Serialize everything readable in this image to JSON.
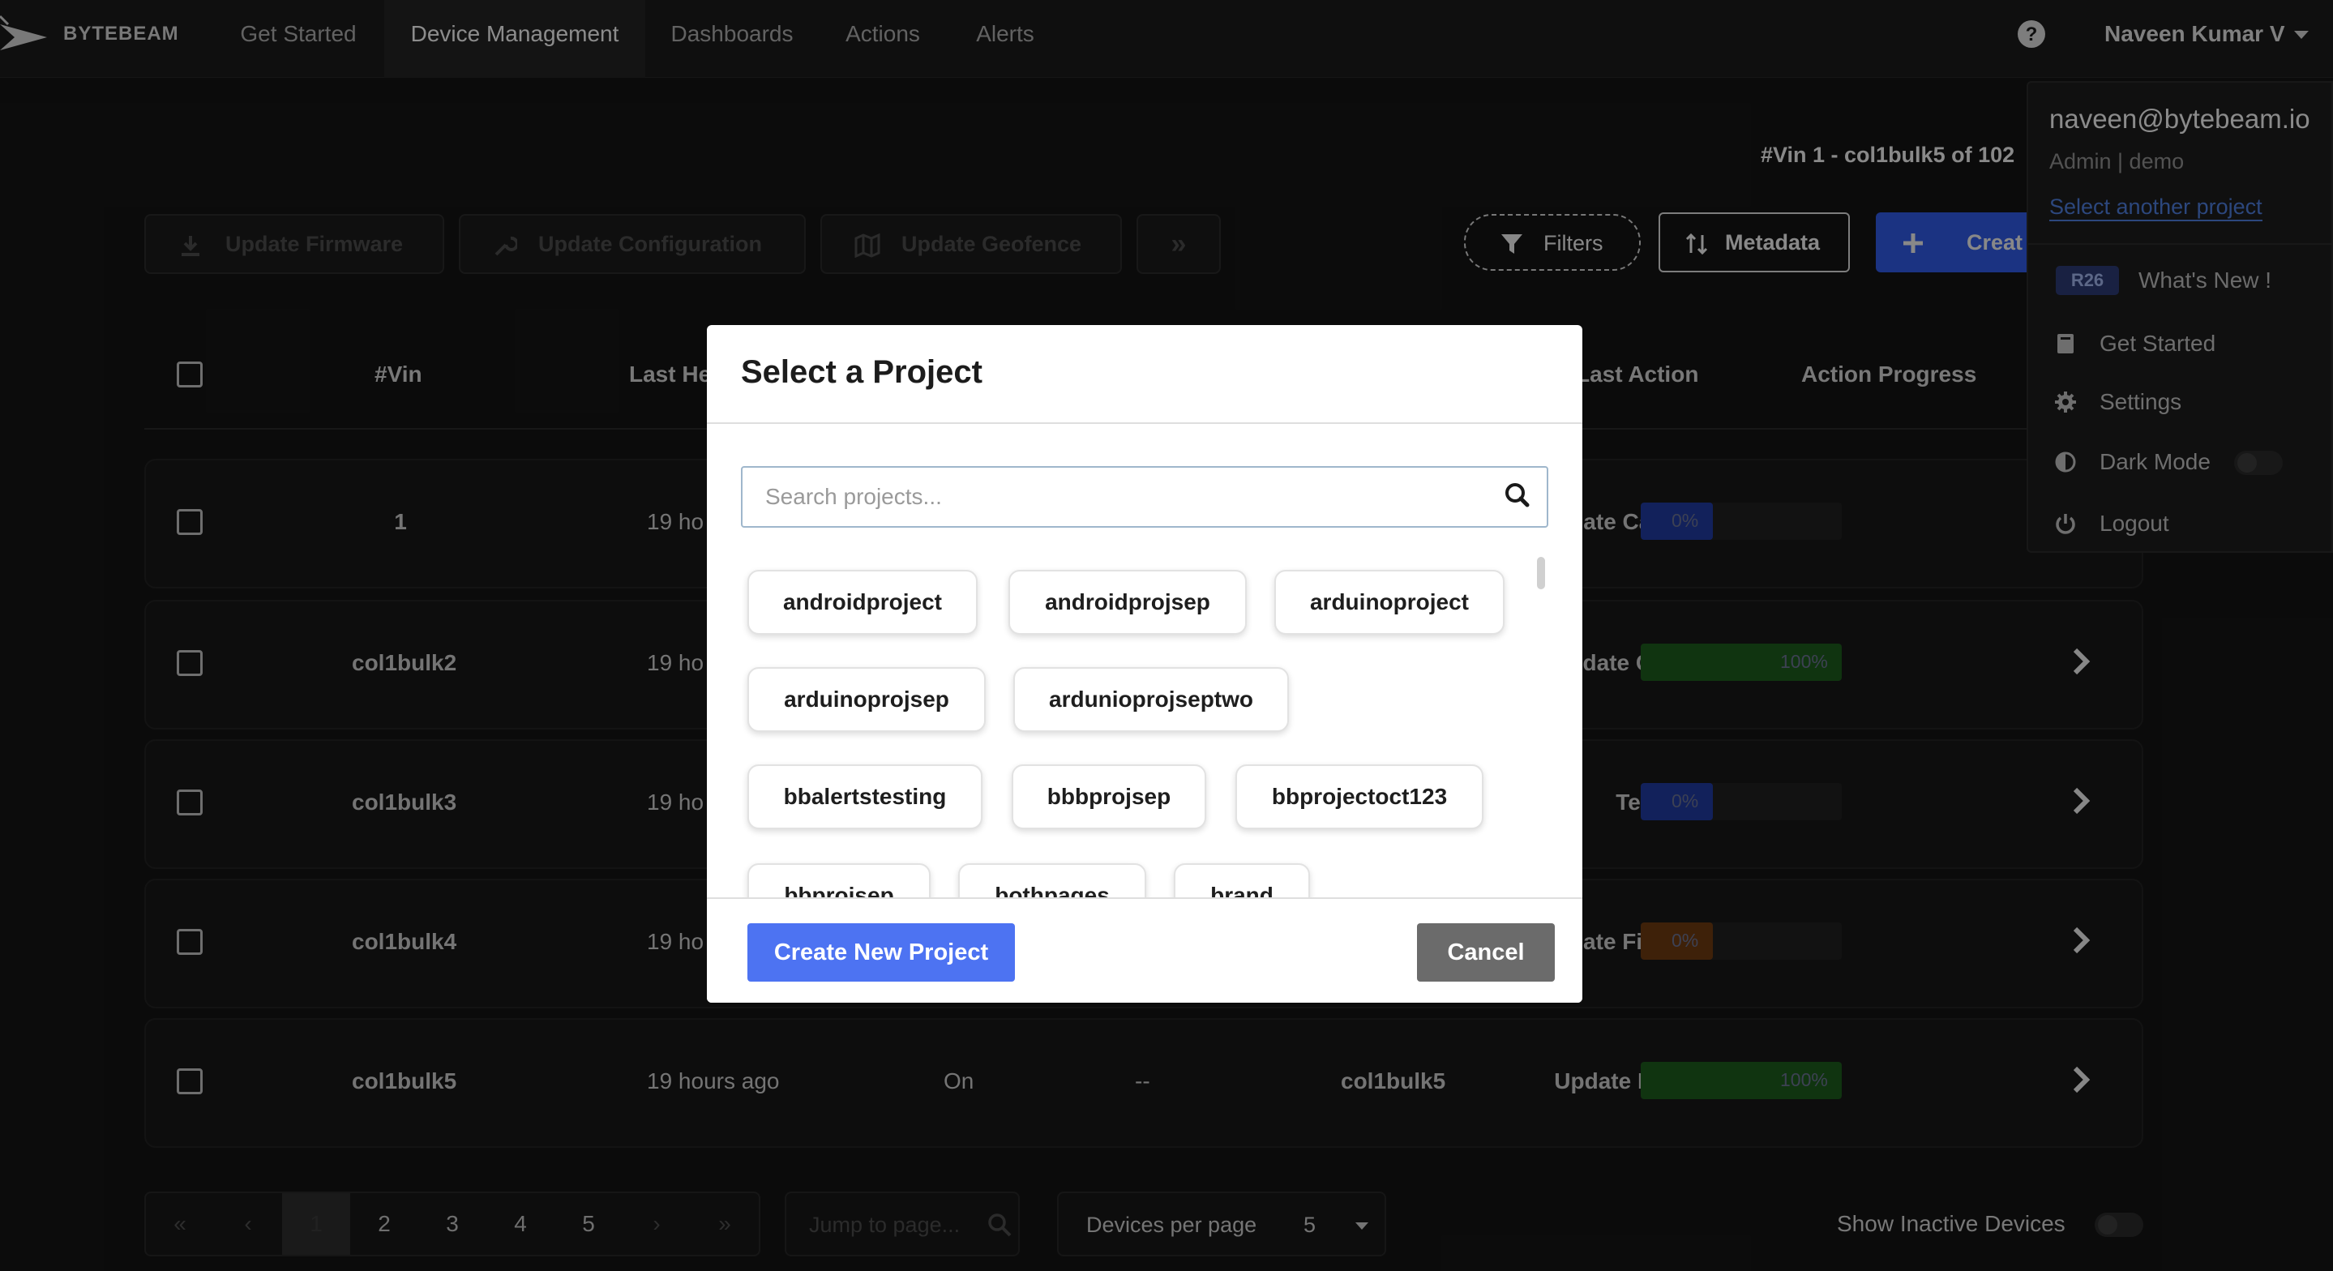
{
  "navbar": {
    "brand": "BYTEBEAM",
    "items": [
      {
        "label": "Get Started"
      },
      {
        "label": "Device Management"
      },
      {
        "label": "Dashboards"
      },
      {
        "label": "Actions"
      },
      {
        "label": "Alerts"
      }
    ],
    "active_item": "Device Management",
    "user_name": "Naveen Kumar V"
  },
  "user_menu": {
    "email": "naveen@bytebeam.io",
    "role": "Admin | demo",
    "switch_project": "Select another project",
    "release_badge": "R26",
    "whats_new": "What's New !",
    "items": [
      {
        "label": "Get Started",
        "icon": "book-icon"
      },
      {
        "label": "Settings",
        "icon": "gear-icon"
      },
      {
        "label": "Dark Mode",
        "icon": "contrast-icon"
      },
      {
        "label": "Logout",
        "icon": "power-icon"
      }
    ]
  },
  "device_page": {
    "summary": "#Vin 1 - col1bulk5 of 102",
    "toolbar": {
      "update_firmware": "Update Firmware",
      "update_configuration": "Update Configuration",
      "update_geofence": "Update Geofence",
      "more": "»",
      "filters": "Filters",
      "metadata": "Metadata",
      "create": "Creat"
    },
    "columns": {
      "vin": "#Vin",
      "last_heartbeat": "Last He",
      "last_action": "Last Action",
      "action_progress": "Action Progress"
    },
    "rows": [
      {
        "vin": "1",
        "heartbeat": "19 ho",
        "status": "",
        "col4": "",
        "col5": "",
        "last_action": "date Can C...",
        "progress": 0,
        "progress_label": "0%",
        "color": "#1f3a9e"
      },
      {
        "vin": "col1bulk2",
        "heartbeat": "19 ho",
        "status": "",
        "col4": "",
        "col5": "",
        "last_action": "pdate Config",
        "progress": 100,
        "progress_label": "100%",
        "color": "#1c5a1c"
      },
      {
        "vin": "col1bulk3",
        "heartbeat": "19 ho",
        "status": "",
        "col4": "",
        "col5": "",
        "last_action": "Test",
        "progress": 0,
        "progress_label": "0%",
        "color": "#1f3a9e"
      },
      {
        "vin": "col1bulk4",
        "heartbeat": "19 ho",
        "status": "",
        "col4": "",
        "col5": "",
        "last_action": "date Firmw...",
        "progress": 0,
        "progress_label": "0%",
        "color": "#6b3a10"
      },
      {
        "vin": "col1bulk5",
        "heartbeat": "19 hours ago",
        "status": "On",
        "col4": "--",
        "col5": "col1bulk5",
        "last_action": "Update Firmw...",
        "progress": 100,
        "progress_label": "100%",
        "color": "#1c5a1c"
      }
    ],
    "pagination": {
      "first": "«",
      "prev": "‹",
      "pages": [
        "1",
        "2",
        "3",
        "4",
        "5"
      ],
      "next": "›",
      "last": "»",
      "current": "1",
      "jump_placeholder": "Jump to page...",
      "devices_per_page_label": "Devices per page",
      "devices_per_page_value": "5",
      "show_inactive": "Show Inactive Devices"
    }
  },
  "modal": {
    "title": "Select a Project",
    "search_placeholder": "Search projects...",
    "projects": [
      "androidproject",
      "androidprojsep",
      "arduinoproject",
      "arduinoprojsep",
      "ardunioprojseptwo",
      "bbalertstesting",
      "bbbprojsep",
      "bbprojectoct123",
      "bbprojsep",
      "bothpages",
      "brand"
    ],
    "create_button": "Create New Project",
    "cancel_button": "Cancel"
  }
}
